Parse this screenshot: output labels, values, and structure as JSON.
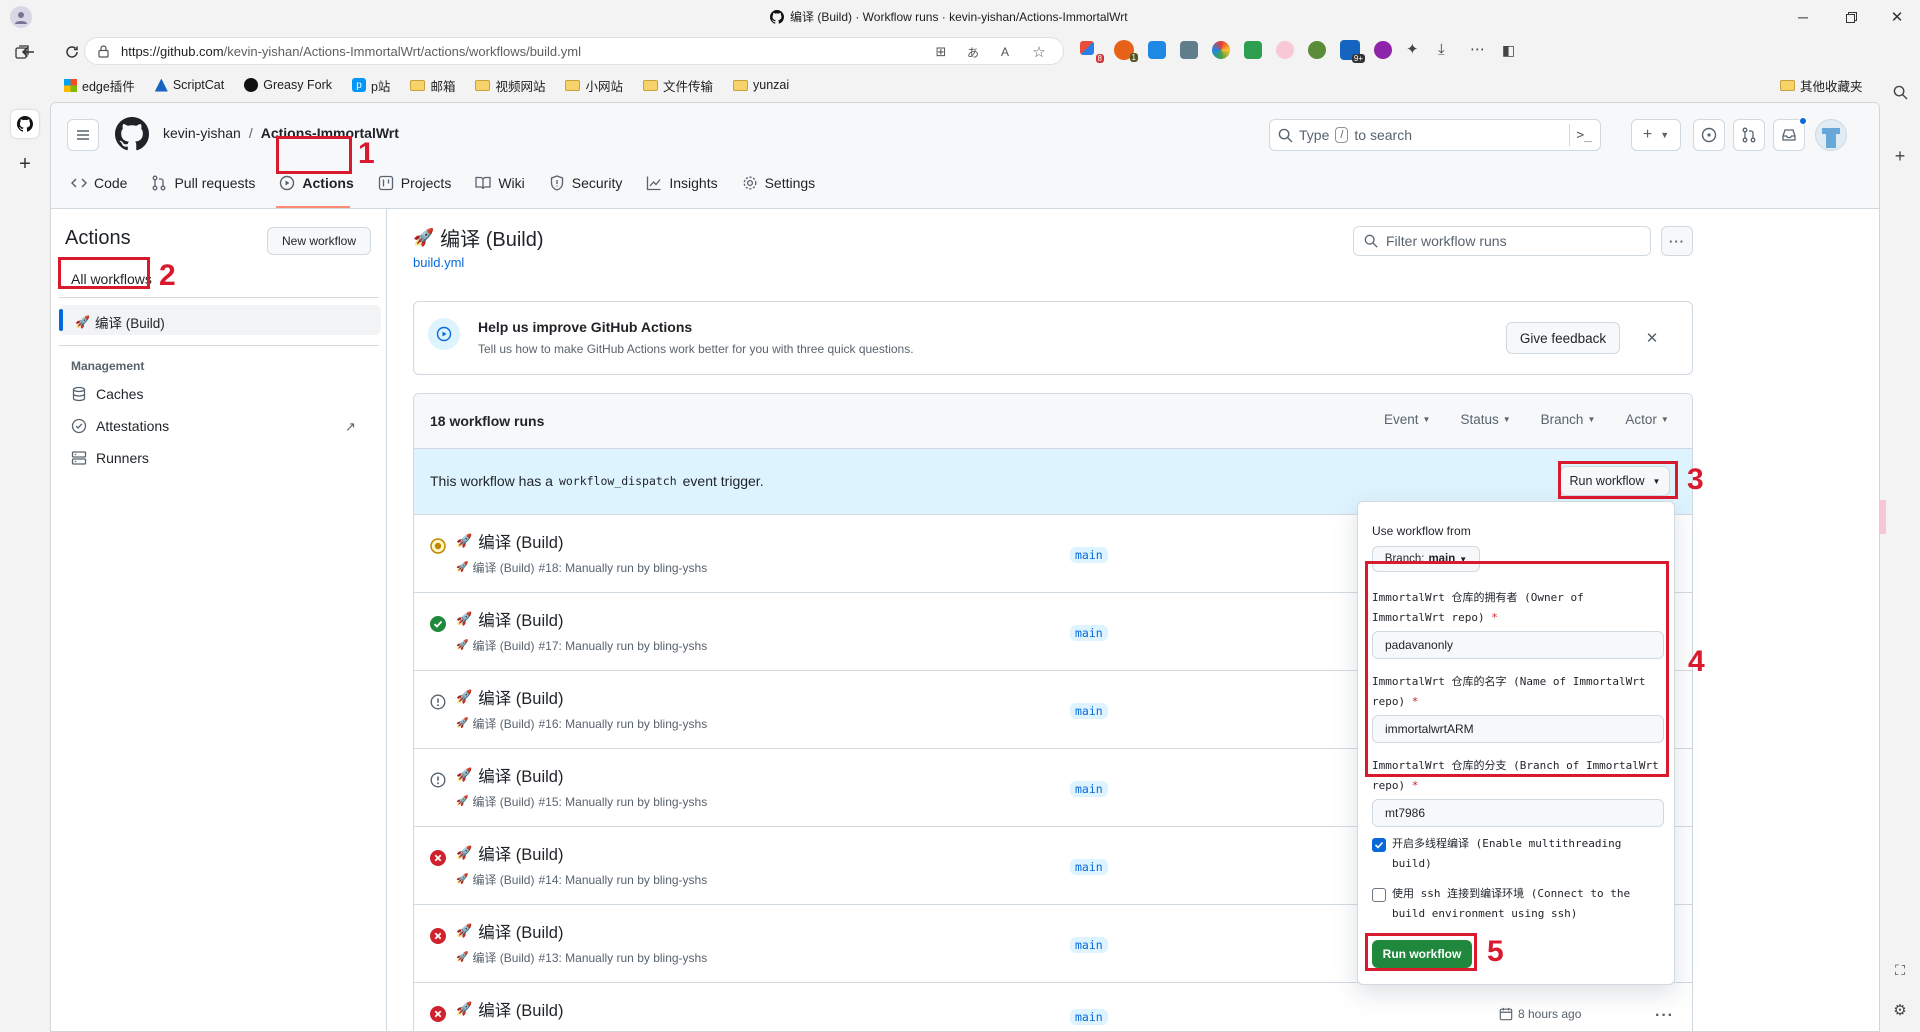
{
  "browser": {
    "window_title": "编译 (Build) · Workflow runs · kevin-yishan/Actions-ImmortalWrt",
    "url": "https://github.com/kevin-yishan/Actions-ImmortalWrt/actions/workflows/build.yml",
    "url_prefix": "https://github.com",
    "url_rest": "/kevin-yishan/Actions-ImmortalWrt/actions/workflows/build.yml",
    "bookmarks": [
      "edge插件",
      "ScriptCat",
      "Greasy Fork",
      "p站",
      "邮箱",
      "视频网站",
      "小网站",
      "文件传输",
      "yunzai"
    ],
    "other_favorites": "其他收藏夹",
    "extension_badges": {
      "ext1": "8",
      "ext2": "9+"
    }
  },
  "header": {
    "owner": "kevin-yishan",
    "separator": "/",
    "repo": "Actions-ImmortalWrt",
    "search_placeholder_pre": "Type",
    "search_key": "/",
    "search_placeholder_post": "to search"
  },
  "repo_nav": {
    "tabs": [
      "Code",
      "Pull requests",
      "Actions",
      "Projects",
      "Wiki",
      "Security",
      "Insights",
      "Settings"
    ]
  },
  "sidebar": {
    "title": "Actions",
    "new_workflow": "New workflow",
    "all_workflows": "All workflows",
    "workflow_item": "编译 (Build)",
    "management_heading": "Management",
    "management_items": [
      "Caches",
      "Attestations",
      "Runners"
    ]
  },
  "workflow": {
    "title": "编译 (Build)",
    "file": "build.yml",
    "filter_placeholder": "Filter workflow runs"
  },
  "feedback": {
    "title": "Help us improve GitHub Actions",
    "subtitle": "Tell us how to make GitHub Actions work better for you with three quick questions.",
    "button": "Give feedback"
  },
  "runs": {
    "count_label": "18 workflow runs",
    "filters": [
      "Event",
      "Status",
      "Branch",
      "Actor"
    ],
    "dispatch_pre": "This workflow has a",
    "dispatch_code": "workflow_dispatch",
    "dispatch_post": "event trigger.",
    "run_workflow_button": "Run workflow",
    "items": [
      {
        "status": "in-progress",
        "title": "编译 (Build)",
        "sub_workflow": "编译 (Build)",
        "sub_rest": "#18: Manually run by bling-yshs",
        "branch": "main"
      },
      {
        "status": "success",
        "title": "编译 (Build)",
        "sub_workflow": "编译 (Build)",
        "sub_rest": "#17: Manually run by bling-yshs",
        "branch": "main"
      },
      {
        "status": "cancelled",
        "title": "编译 (Build)",
        "sub_workflow": "编译 (Build)",
        "sub_rest": "#16: Manually run by bling-yshs",
        "branch": "main"
      },
      {
        "status": "cancelled",
        "title": "编译 (Build)",
        "sub_workflow": "编译 (Build)",
        "sub_rest": "#15: Manually run by bling-yshs",
        "branch": "main"
      },
      {
        "status": "failure",
        "title": "编译 (Build)",
        "sub_workflow": "编译 (Build)",
        "sub_rest": "#14: Manually run by bling-yshs",
        "branch": "main"
      },
      {
        "status": "failure",
        "title": "编译 (Build)",
        "sub_workflow": "编译 (Build)",
        "sub_rest": "#13: Manually run by bling-yshs",
        "branch": "main"
      },
      {
        "status": "failure",
        "title": "编译 (Build)",
        "sub_workflow": "",
        "sub_rest": "",
        "branch": "main"
      }
    ],
    "last_time": "8 hours ago"
  },
  "dropdown": {
    "use_from": "Use workflow from",
    "branch_label": "Branch:",
    "branch_value": "main",
    "field1_label": "ImmortalWrt 仓库的拥有者 (Owner of ImmortalWrt repo)",
    "field1_value": "padavanonly",
    "field2_label": "ImmortalWrt 仓库的名字 (Name of ImmortalWrt repo)",
    "field2_value": "immortalwrtARM",
    "field3_label": "ImmortalWrt 仓库的分支 (Branch of ImmortalWrt repo)",
    "field3_value": "mt7986",
    "required_mark": "*",
    "check1_label": "开启多线程编译 (Enable multithreading build)",
    "check1_checked": true,
    "check2_label": "使用 ssh 连接到编译环境 (Connect to the build environment using ssh)",
    "check2_checked": false,
    "submit": "Run workflow"
  },
  "annotations": [
    "1",
    "2",
    "3",
    "4",
    "5"
  ],
  "colors": {
    "accent": "#0969da",
    "green": "#1f883d",
    "red_annotation": "#d8192e",
    "danger": "#cf222e",
    "warning": "#bf8700"
  }
}
